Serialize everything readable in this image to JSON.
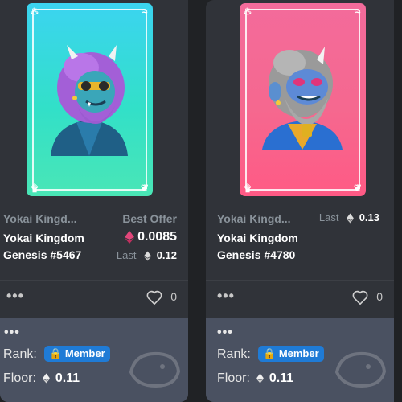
{
  "cards": [
    {
      "collection": "Yokai Kingd...",
      "name": "Yokai Kingdom Genesis #5467",
      "price_label": "Best Offer",
      "price": "0.0085",
      "last_label": "Last",
      "last_price": "0.12",
      "likes": "0",
      "rank_label": "Rank:",
      "badge": "Member",
      "floor_label": "Floor:",
      "floor_price": "0.11"
    },
    {
      "collection": "Yokai Kingd...",
      "name": "Yokai Kingdom Genesis #4780",
      "last_label": "Last",
      "last_price": "0.13",
      "likes": "0",
      "rank_label": "Rank:",
      "badge": "Member",
      "floor_label": "Floor:",
      "floor_price": "0.11"
    }
  ],
  "icons": {
    "eth": "ethereum-icon",
    "heart": "heart-icon",
    "lock": "lock-icon",
    "more": "more-icon",
    "whale": "whale-icon"
  },
  "colors": {
    "background": "#202225",
    "card": "#303339",
    "footer": "#4a5161",
    "badge": "#1f7bd6",
    "art1": "#3bd4f0",
    "art2": "#f36b9b"
  }
}
